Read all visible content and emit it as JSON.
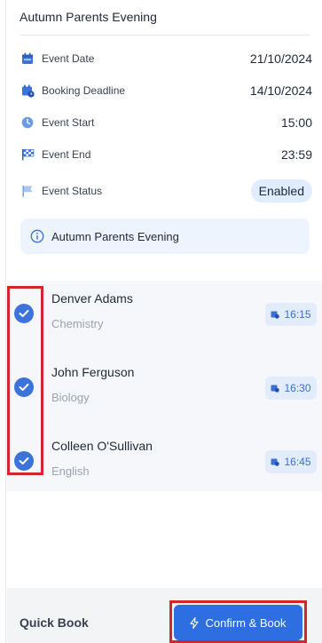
{
  "event": {
    "title": "Autumn Parents Evening",
    "rows": [
      {
        "icon": "calendar-icon",
        "label": "Event Date",
        "value": "21/10/2024"
      },
      {
        "icon": "calendar-clock-icon",
        "label": "Booking Deadline",
        "value": "14/10/2024"
      },
      {
        "icon": "clock-icon",
        "label": "Event Start",
        "value": "15:00"
      },
      {
        "icon": "checkered-flag-icon",
        "label": "Event End",
        "value": "23:59"
      },
      {
        "icon": "flag-icon",
        "label": "Event Status",
        "value": "Enabled"
      }
    ],
    "banner_text": "Autumn Parents Evening"
  },
  "appointments": [
    {
      "teacher": "Denver Adams",
      "subject": "Chemistry",
      "time": "16:15",
      "checked": true
    },
    {
      "teacher": "John Ferguson",
      "subject": "Biology",
      "time": "16:30",
      "checked": true
    },
    {
      "teacher": "Colleen O'Sullivan",
      "subject": "English",
      "time": "16:45",
      "checked": true
    }
  ],
  "footer": {
    "title": "Quick Book",
    "confirm_label": "Confirm & Book"
  },
  "colors": {
    "accent": "#2d6fe0",
    "highlight_outline": "#d4252e",
    "status_pill_bg": "#e0ecff"
  }
}
